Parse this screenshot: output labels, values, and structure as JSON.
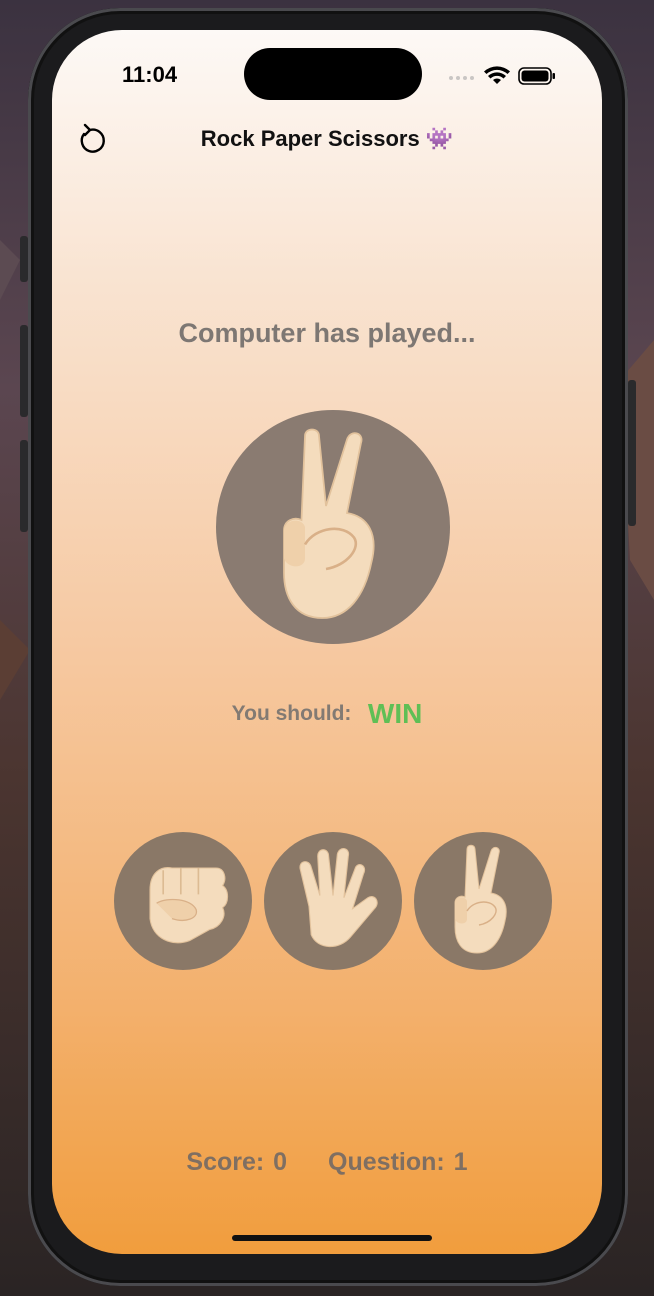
{
  "status": {
    "time": "11:04"
  },
  "nav": {
    "title": "Rock Paper Scissors 👾"
  },
  "game": {
    "prompt": "Computer has played...",
    "computer_move": "scissors-hand-icon",
    "instruction_label": "You should:",
    "instruction_value": "WIN",
    "choices": [
      "rock-hand-icon",
      "paper-hand-icon",
      "scissors-hand-icon"
    ]
  },
  "footer": {
    "score": "Score: 0",
    "question": "Question: 1"
  },
  "colors": {
    "win": "#5fbf55",
    "circle": "#8a7867",
    "text_muted": "#7d7773"
  }
}
